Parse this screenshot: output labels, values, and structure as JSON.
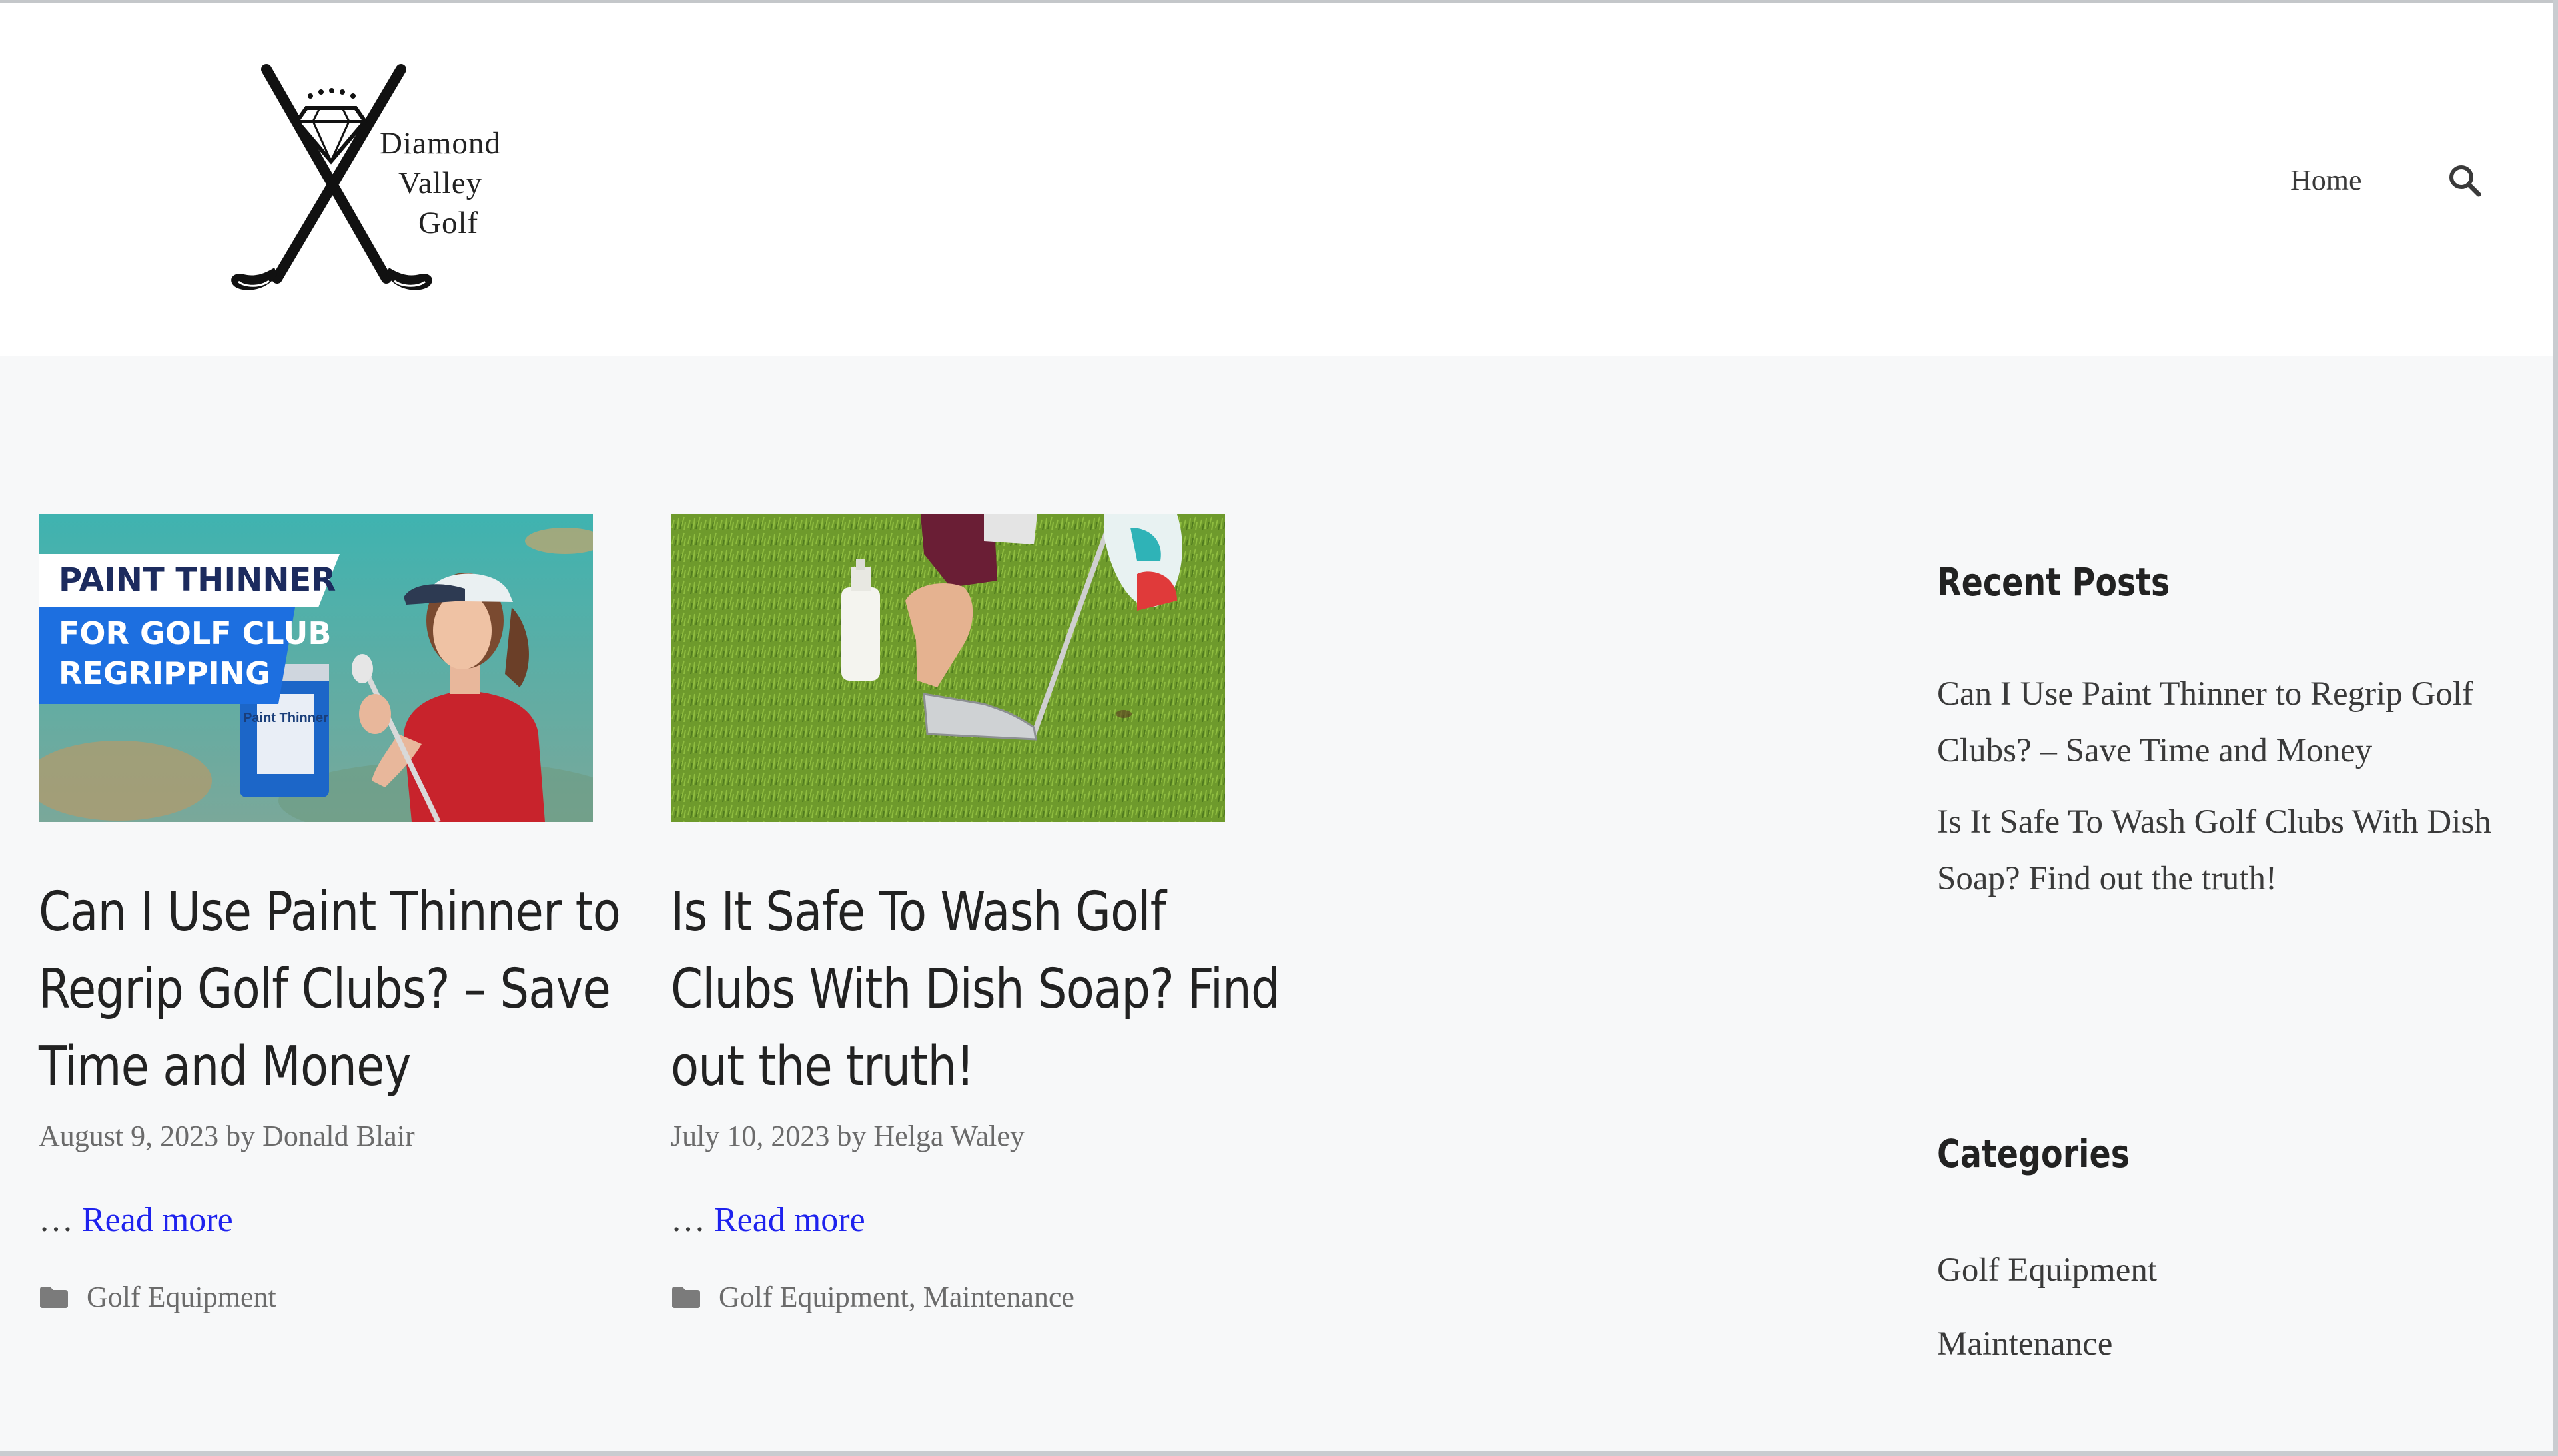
{
  "site": {
    "logo_lines": [
      "Diamond",
      "Valley",
      "Golf"
    ]
  },
  "nav": {
    "home_label": "Home"
  },
  "posts": [
    {
      "banner_line1": "PAINT THINNER",
      "banner_line2": "FOR GOLF CLUB",
      "banner_line3": "REGRIPPING",
      "can_label": "Paint Thinner",
      "title_lines": [
        "Can I Use Paint Thinner to",
        "Regrip Golf Clubs? – Save",
        "Time and Money"
      ],
      "date": "August 9, 2023",
      "by": "by",
      "author": "Donald Blair",
      "ellipsis": "…",
      "read_more": "Read more",
      "categories": "Golf Equipment"
    },
    {
      "title_lines": [
        "Is It Safe To Wash Golf",
        "Clubs With Dish Soap? Find",
        "out the truth!"
      ],
      "date": "July 10, 2023",
      "by": "by",
      "author": "Helga Waley",
      "ellipsis": "…",
      "read_more": "Read more",
      "categories": "Golf Equipment, Maintenance"
    }
  ],
  "sidebar": {
    "recent_title": "Recent Posts",
    "recent": [
      "Can I Use Paint Thinner to Regrip Golf Clubs? – Save Time and Money",
      "Is It Safe To Wash Golf Clubs With Dish Soap? Find out the truth!"
    ],
    "categories_title": "Categories",
    "categories": [
      "Golf Equipment",
      "Maintenance"
    ]
  },
  "colors": {
    "link": "#1e22ee",
    "text": "#3a3a3a",
    "header_bg": "#ffffff",
    "page_bg": "#f7f8f9"
  },
  "icons": [
    "logo-crossed-clubs-icon",
    "diamond-icon",
    "search-icon",
    "folder-icon"
  ]
}
